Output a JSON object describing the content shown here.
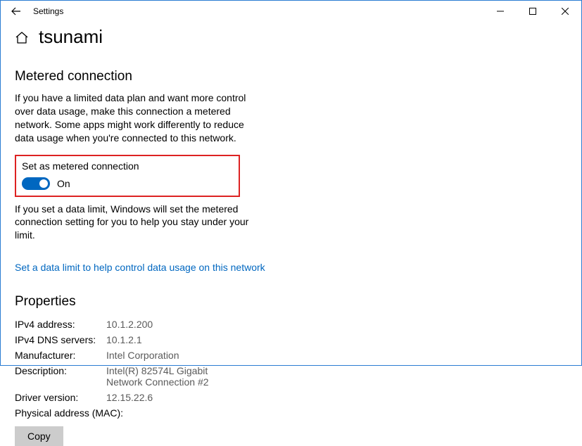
{
  "window": {
    "title": "Settings"
  },
  "page": {
    "title": "tsunami"
  },
  "metered": {
    "section_title": "Metered connection",
    "description": "If you have a limited data plan and want more control over data usage, make this connection a metered network. Some apps might work differently to reduce data usage when you're connected to this network.",
    "toggle_label": "Set as metered connection",
    "toggle_state": "On",
    "sub_description": "If you set a data limit, Windows will set the metered connection setting for you to help you stay under your limit.",
    "link_text": "Set a data limit to help control data usage on this network"
  },
  "properties": {
    "section_title": "Properties",
    "rows": {
      "ipv4_addr": {
        "label": "IPv4 address:",
        "value": "10.1.2.200"
      },
      "ipv4_dns": {
        "label": "IPv4 DNS servers:",
        "value": "10.1.2.1"
      },
      "manufacturer": {
        "label": "Manufacturer:",
        "value": "Intel Corporation"
      },
      "description": {
        "label": "Description:",
        "value": "Intel(R) 82574L Gigabit Network Connection #2"
      },
      "driver_version": {
        "label": "Driver version:",
        "value": "12.15.22.6"
      },
      "mac": {
        "label": "Physical address (MAC):",
        "value": ""
      }
    },
    "copy_label": "Copy"
  }
}
